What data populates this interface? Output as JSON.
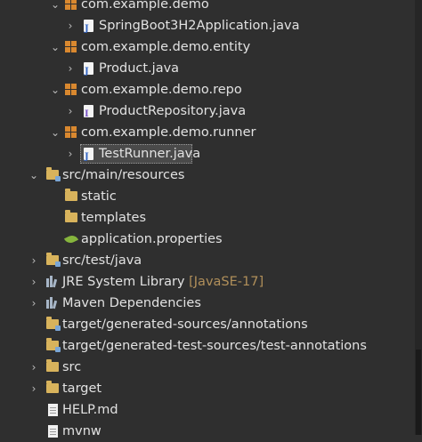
{
  "tree": [
    {
      "label": "com.example.demo",
      "icon": "package-icon",
      "expanded": true
    },
    {
      "label": "SpringBoot3H2Application.java",
      "icon": "java-class-icon",
      "expanded": false
    },
    {
      "label": "com.example.demo.entity",
      "icon": "package-icon",
      "expanded": true
    },
    {
      "label": "Product.java",
      "icon": "java-class-icon",
      "expanded": false
    },
    {
      "label": "com.example.demo.repo",
      "icon": "package-icon",
      "expanded": true
    },
    {
      "label": "ProductRepository.java",
      "icon": "java-interface-icon",
      "expanded": false
    },
    {
      "label": "com.example.demo.runner",
      "icon": "package-icon",
      "expanded": true
    },
    {
      "label": "TestRunner.java",
      "icon": "java-class-icon",
      "expanded": false,
      "selected": true
    },
    {
      "label": "src/main/resources",
      "icon": "source-folder-icon",
      "expanded": true
    },
    {
      "label": "static",
      "icon": "folder-icon"
    },
    {
      "label": "templates",
      "icon": "folder-icon"
    },
    {
      "label": "application.properties",
      "icon": "properties-file-icon"
    },
    {
      "label": "src/test/java",
      "icon": "source-folder-icon",
      "expanded": false
    },
    {
      "label": "JRE System Library",
      "decoration": "[JavaSE-17]",
      "icon": "library-icon",
      "expanded": false
    },
    {
      "label": "Maven Dependencies",
      "icon": "library-icon",
      "expanded": false
    },
    {
      "label": "target/generated-sources/annotations",
      "icon": "source-folder-icon"
    },
    {
      "label": "target/generated-test-sources/test-annotations",
      "icon": "source-folder-icon"
    },
    {
      "label": "src",
      "icon": "folder-icon",
      "expanded": false
    },
    {
      "label": "target",
      "icon": "folder-icon",
      "expanded": false
    },
    {
      "label": "HELP.md",
      "icon": "file-icon"
    },
    {
      "label": "mvnw",
      "icon": "file-icon"
    }
  ]
}
